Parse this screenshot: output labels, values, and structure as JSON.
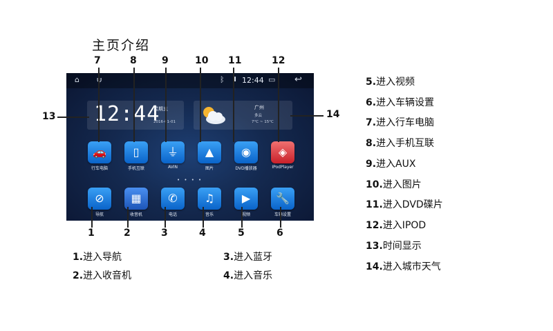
{
  "title": "主页介绍",
  "status_bar": {
    "time": "12:44"
  },
  "clock_widget": {
    "time": "12:44",
    "weekday": "星期五",
    "date": "2016-01-01"
  },
  "weather_widget": {
    "city": "广州",
    "condition": "多云",
    "temperature": "7°C ~ 15°C"
  },
  "apps_row1": [
    {
      "label": "行车电脑",
      "icon": "car-icon"
    },
    {
      "label": "手机互联",
      "icon": "phone-link-icon"
    },
    {
      "label": "AVIN",
      "icon": "avin-plug-icon"
    },
    {
      "label": "图片",
      "icon": "picture-icon"
    },
    {
      "label": "DVD播放器",
      "icon": "dvd-disc-icon"
    },
    {
      "label": "IPodPlayer",
      "icon": "ipod-icon"
    }
  ],
  "apps_row2": [
    {
      "label": "导航",
      "icon": "compass-icon"
    },
    {
      "label": "收音机",
      "icon": "radio-icon"
    },
    {
      "label": "电话",
      "icon": "phone-icon"
    },
    {
      "label": "音乐",
      "icon": "music-icon"
    },
    {
      "label": "视频",
      "icon": "play-icon"
    },
    {
      "label": "车辆设置",
      "icon": "wrench-icon"
    }
  ],
  "callouts": {
    "top": [
      "7",
      "8",
      "9",
      "10",
      "11",
      "12"
    ],
    "bottom": [
      "1",
      "2",
      "3",
      "4",
      "5",
      "6"
    ],
    "left": "13",
    "right": "14"
  },
  "legend_bottom": [
    {
      "num": "1.",
      "text": "进入导航"
    },
    {
      "num": "2.",
      "text": "进入收音机"
    },
    {
      "num": "3.",
      "text": "进入蓝牙"
    },
    {
      "num": "4.",
      "text": "进入音乐"
    }
  ],
  "legend_right": [
    {
      "num": "5.",
      "text": "进入视频"
    },
    {
      "num": "6.",
      "text": "进入车辆设置"
    },
    {
      "num": "7.",
      "text": "进入行车电脑"
    },
    {
      "num": "8.",
      "text": "进入手机互联"
    },
    {
      "num": "9.",
      "text": "进入AUX"
    },
    {
      "num": "10.",
      "text": "进入图片"
    },
    {
      "num": "11.",
      "text": "进入DVD碟片"
    },
    {
      "num": "12.",
      "text": "进入IPOD"
    },
    {
      "num": "13.",
      "text": "时间显示"
    },
    {
      "num": "14.",
      "text": "进入城市天气"
    }
  ]
}
